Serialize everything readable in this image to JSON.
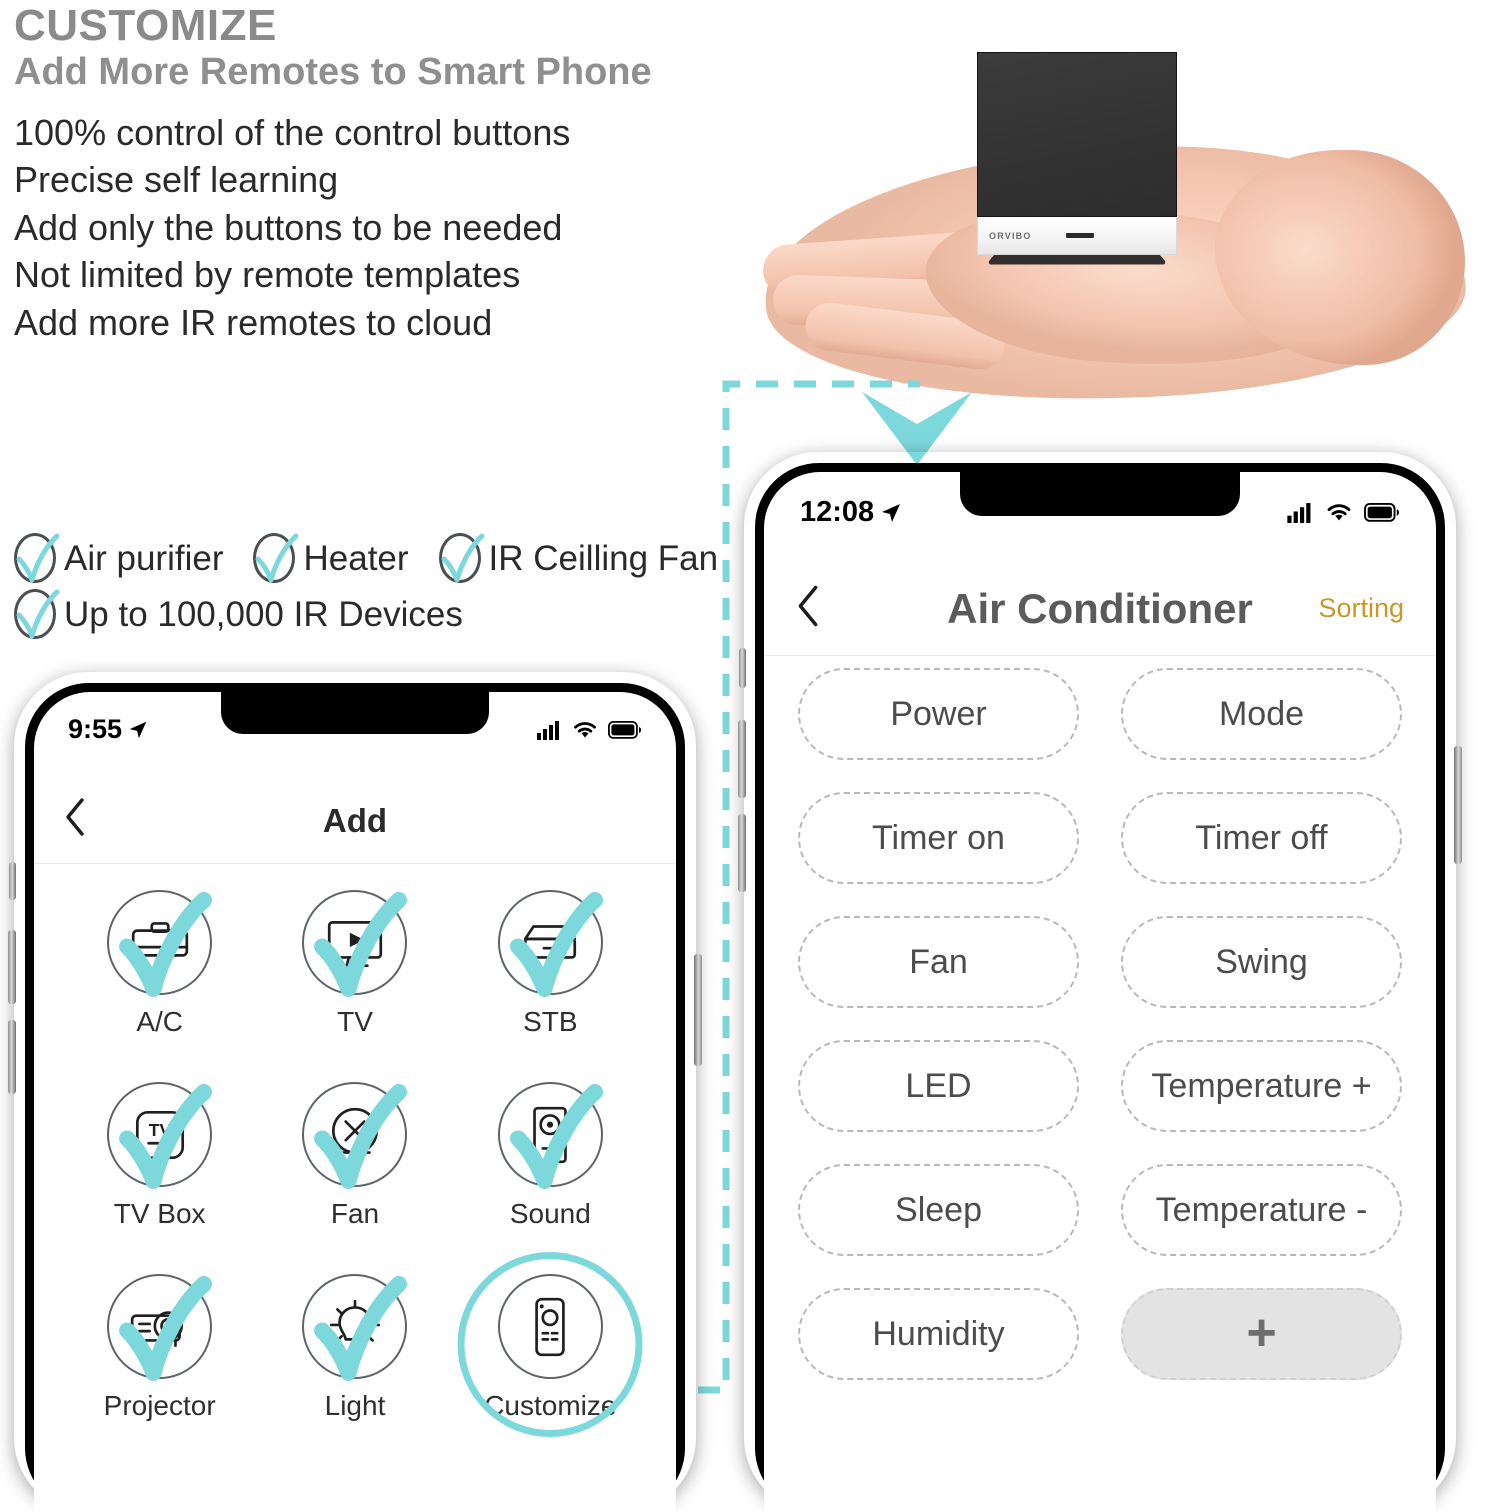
{
  "marketing": {
    "heading": "CUSTOMIZE",
    "subheading": "Add More Remotes to Smart Phone",
    "bullets": [
      "100% control of the control buttons",
      "Precise self learning",
      "Add only the buttons to be needed",
      "Not limited by remote templates",
      "Add more IR remotes to cloud"
    ],
    "checklist": [
      "Air purifier",
      "Heater",
      "IR Ceilling Fan",
      "Up to 100,000 IR Devices"
    ]
  },
  "product": {
    "brand": "ORVIBO"
  },
  "colors": {
    "accent_cyan": "#7dd8dc",
    "heading_gray": "#8a8a8a",
    "body_text": "#2a2a2a",
    "sorting_gold": "#c8972e",
    "button_border": "#b9b9b9",
    "add_button_fill": "#e3e3e3"
  },
  "phone_left": {
    "status": {
      "time": "9:55",
      "location_icon": "location-arrow-icon",
      "signal_icon": "cellular-signal-icon",
      "wifi_icon": "wifi-icon",
      "battery_icon": "battery-icon"
    },
    "nav": {
      "back_icon": "chevron-left-icon",
      "title": "Add"
    },
    "devices": [
      {
        "label": "A/C",
        "icon": "air-conditioner-icon",
        "checked": true,
        "highlighted": false
      },
      {
        "label": "TV",
        "icon": "television-icon",
        "checked": true,
        "highlighted": false
      },
      {
        "label": "STB",
        "icon": "set-top-box-icon",
        "checked": true,
        "highlighted": false
      },
      {
        "label": "TV Box",
        "icon": "tv-box-icon",
        "checked": true,
        "highlighted": false
      },
      {
        "label": "Fan",
        "icon": "fan-icon",
        "checked": true,
        "highlighted": false
      },
      {
        "label": "Sound",
        "icon": "speaker-icon",
        "checked": true,
        "highlighted": false
      },
      {
        "label": "Projector",
        "icon": "projector-icon",
        "checked": true,
        "highlighted": false
      },
      {
        "label": "Light",
        "icon": "light-bulb-icon",
        "checked": true,
        "highlighted": false
      },
      {
        "label": "Customize",
        "icon": "remote-control-icon",
        "checked": false,
        "highlighted": true
      }
    ]
  },
  "phone_right": {
    "status": {
      "time": "12:08",
      "location_icon": "location-arrow-icon",
      "signal_icon": "cellular-signal-icon",
      "wifi_icon": "wifi-icon",
      "battery_icon": "battery-icon"
    },
    "nav": {
      "back_icon": "chevron-left-icon",
      "title": "Air Conditioner",
      "action": "Sorting"
    },
    "buttons": [
      {
        "label": "Power",
        "type": "normal"
      },
      {
        "label": "Mode",
        "type": "normal"
      },
      {
        "label": "Timer on",
        "type": "normal"
      },
      {
        "label": "Timer off",
        "type": "normal"
      },
      {
        "label": "Fan",
        "type": "normal"
      },
      {
        "label": "Swing",
        "type": "normal"
      },
      {
        "label": "LED",
        "type": "normal"
      },
      {
        "label": "Temperature +",
        "type": "normal"
      },
      {
        "label": "Sleep",
        "type": "normal"
      },
      {
        "label": "Temperature -",
        "type": "normal"
      },
      {
        "label": "Humidity",
        "type": "normal"
      },
      {
        "label": "+",
        "type": "add"
      }
    ]
  }
}
